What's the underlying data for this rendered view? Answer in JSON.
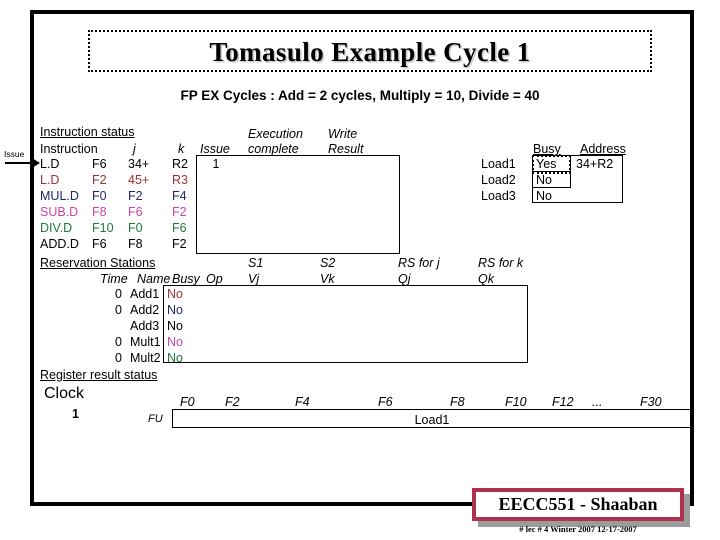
{
  "slide": {
    "title": "Tomasulo Example Cycle 1",
    "subtitle": "FP EX Cycles :  Add = 2 cycles, Multiply = 10, Divide = 40",
    "issue_arrow_label": "Issue"
  },
  "instruction_status": {
    "section_label": "Instruction status",
    "headers": {
      "instruction": "Instruction",
      "j": "j",
      "k": "k",
      "issue": "Issue",
      "execution": "Execution",
      "complete": "complete",
      "write": "Write",
      "result": "Result"
    },
    "rows": [
      {
        "op": "L.D",
        "dest": "F6",
        "j": "34+",
        "k": "R2",
        "issue": "1",
        "exec": "",
        "write": "",
        "color": "#000000"
      },
      {
        "op": "L.D",
        "dest": "F2",
        "j": "45+",
        "k": "R3",
        "issue": "",
        "exec": "",
        "write": "",
        "color": "#993333"
      },
      {
        "op": "MUL.D",
        "dest": "F0",
        "j": "F2",
        "k": "F4",
        "issue": "",
        "exec": "",
        "write": "",
        "color": "#1f2a6e"
      },
      {
        "op": "SUB.D",
        "dest": "F8",
        "j": "F6",
        "k": "F2",
        "issue": "",
        "exec": "",
        "write": "",
        "color": "#cc44aa"
      },
      {
        "op": "DIV.D",
        "dest": "F10",
        "j": "F0",
        "k": "F6",
        "issue": "",
        "exec": "",
        "write": "",
        "color": "#1f7a3d"
      },
      {
        "op": "ADD.D",
        "dest": "F6",
        "j": "F8",
        "k": "F2",
        "issue": "",
        "exec": "",
        "write": "",
        "color": "#000000"
      }
    ]
  },
  "load_buffers": {
    "headers": {
      "busy": "Busy",
      "address": "Address"
    },
    "rows": [
      {
        "name": "Load1",
        "busy": "Yes",
        "address": "34+R2",
        "highlight": true
      },
      {
        "name": "Load2",
        "busy": "No",
        "address": "",
        "highlight": false
      },
      {
        "name": "Load3",
        "busy": "No",
        "address": "",
        "highlight": false
      }
    ]
  },
  "reservation_stations": {
    "section_label": "Reservation Stations",
    "headers": {
      "time": "Time",
      "name": "Name",
      "busy": "Busy",
      "op": "Op",
      "s1": "S1",
      "vj": "Vj",
      "s2": "S2",
      "vk": "Vk",
      "rs_for_j": "RS for j",
      "qj": "Qj",
      "rs_for_k": "RS for k",
      "qk": "Qk"
    },
    "rows": [
      {
        "time": "0",
        "name": "Add1",
        "busy": "No",
        "op": "",
        "vj": "",
        "vk": "",
        "qj": "",
        "qk": "",
        "color": "#993333"
      },
      {
        "time": "0",
        "name": "Add2",
        "busy": "No",
        "op": "",
        "vj": "",
        "vk": "",
        "qj": "",
        "qk": "",
        "color": "#1f2a6e"
      },
      {
        "time": "",
        "name": "Add3",
        "busy": "No",
        "op": "",
        "vj": "",
        "vk": "",
        "qj": "",
        "qk": "",
        "color": "#000000"
      },
      {
        "time": "0",
        "name": "Mult1",
        "busy": "No",
        "op": "",
        "vj": "",
        "vk": "",
        "qj": "",
        "qk": "",
        "color": "#cc44aa"
      },
      {
        "time": "0",
        "name": "Mult2",
        "busy": "No",
        "op": "",
        "vj": "",
        "vk": "",
        "qj": "",
        "qk": "",
        "color": "#1f7a3d"
      }
    ]
  },
  "register_result_status": {
    "section_label": "Register result status",
    "clock_label": "Clock",
    "clock_value": "1",
    "fu_label": "FU",
    "registers": [
      "F0",
      "F2",
      "F4",
      "F6",
      "F8",
      "F10",
      "F12",
      "...",
      "F30"
    ],
    "fu_value": "Load1"
  },
  "footer": {
    "course": "EECC551 - Shaaban",
    "note": "#  lec # 4  Winter 2007    12-17-2007",
    "accent_color": "#b03050"
  }
}
